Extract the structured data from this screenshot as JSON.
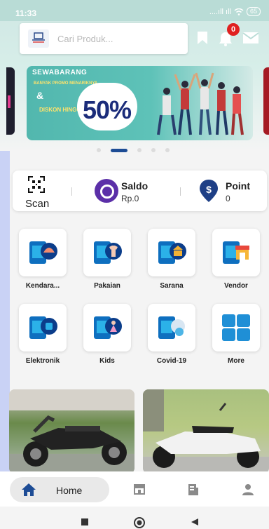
{
  "status": {
    "time": "11:33",
    "signal": "....ıll ıll",
    "battery": "65"
  },
  "search": {
    "placeholder": "Cari Produk...",
    "logo_text": "SEWA BARANG"
  },
  "notifications": {
    "count": "0"
  },
  "banner": {
    "brand": "SEWABARANG",
    "line1": "BANYAK PROMO MENARIKNYA",
    "amp": "&",
    "line2": "DISKON HINGGA",
    "percent": "50%"
  },
  "carousel": {
    "pages": 5,
    "active": 1
  },
  "wallet": {
    "scan_label": "Scan",
    "saldo_title": "Saldo",
    "saldo_value": "Rp.0",
    "point_title": "Point",
    "point_value": "0"
  },
  "categories": [
    {
      "label": "Kendara...",
      "icon": "vehicle-icon"
    },
    {
      "label": "Pakaian",
      "icon": "clothes-icon"
    },
    {
      "label": "Sarana",
      "icon": "facility-icon"
    },
    {
      "label": "Vendor",
      "icon": "vendor-store-icon"
    },
    {
      "label": "Elektronik",
      "icon": "electronics-icon"
    },
    {
      "label": "Kids",
      "icon": "kids-icon"
    },
    {
      "label": "Covid-19",
      "icon": "covid-icon"
    },
    {
      "label": "More",
      "icon": "more-grid-icon"
    }
  ],
  "products": [
    {
      "image": "motorcycle-photo"
    },
    {
      "image": "scooter-photo"
    }
  ],
  "nav": {
    "home_label": "Home",
    "items": [
      "home-icon",
      "shop-icon",
      "orders-icon",
      "profile-icon"
    ]
  },
  "colors": {
    "accent": "#1d4c95",
    "badge": "#e02020",
    "header": "#cfe7e3",
    "saldo": "#5b2fa8",
    "point": "#1e3f86"
  }
}
